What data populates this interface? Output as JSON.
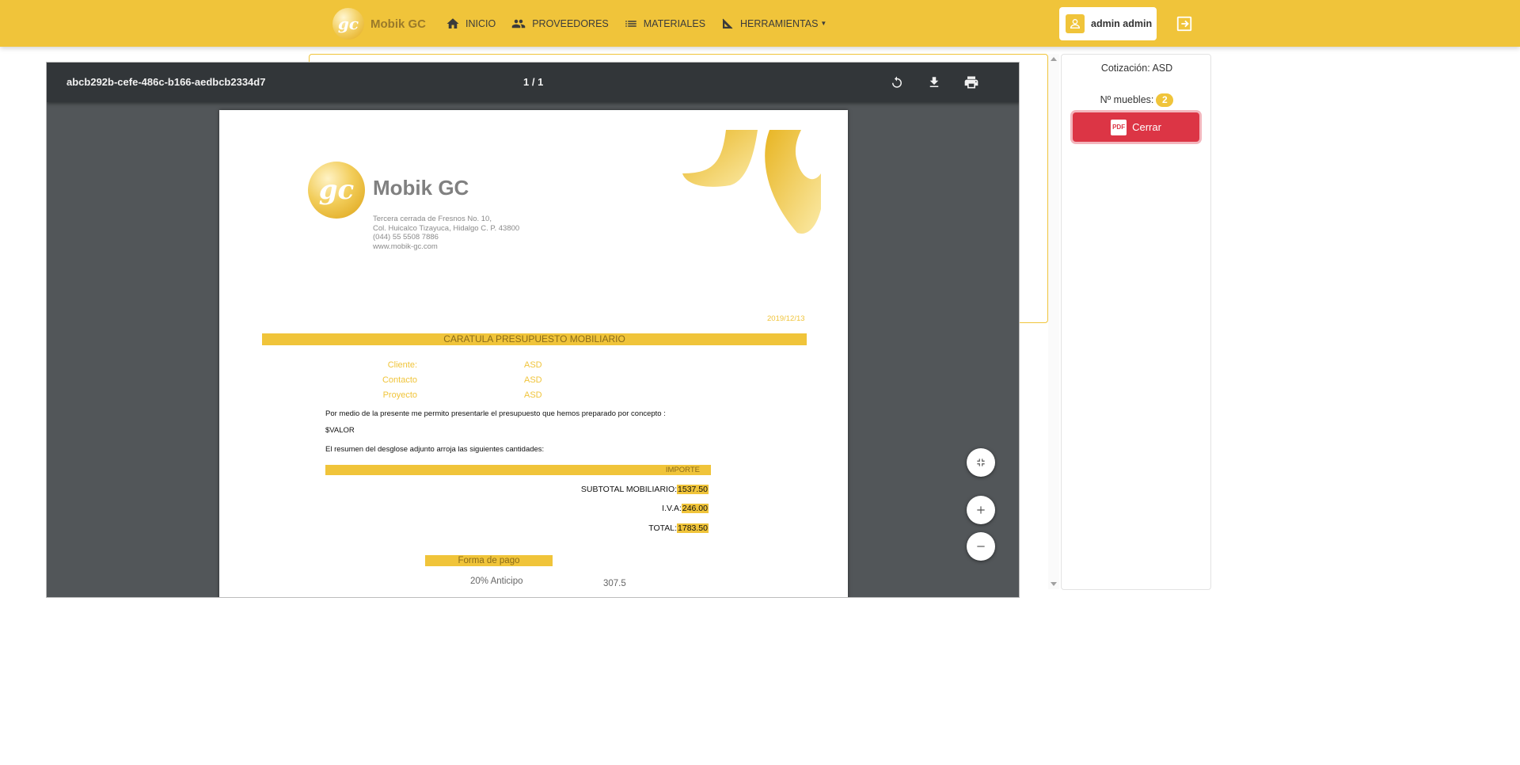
{
  "navbar": {
    "brand_name": "Mobik GC",
    "logo_text": "gc",
    "links": [
      {
        "label": "INICIO",
        "icon": "home-icon"
      },
      {
        "label": "PROVEEDORES",
        "icon": "people-icon"
      },
      {
        "label": "MATERIALES",
        "icon": "list-icon"
      },
      {
        "label": "HERRAMIENTAS",
        "icon": "ruler-icon"
      }
    ],
    "user_label": "admin admin",
    "logout_icon": "logout-icon"
  },
  "viewer": {
    "doc_title": "abcb292b-cefe-486c-b166-aedbcb2334d7",
    "page_counter": "1 / 1",
    "toolbar_icons": [
      "rotate-icon",
      "download-icon",
      "print-icon"
    ],
    "zoom_icons": [
      "fit-page-icon",
      "zoom-in-icon",
      "zoom-out-icon"
    ]
  },
  "document": {
    "brand_name": "Mobik GC",
    "logo_text": "gc",
    "address": [
      "Tercera cerrada de Fresnos No. 10,",
      "Col. Huicalco Tizayuca, Hidalgo  C. P. 43800",
      "(044) 55 5508 7886",
      "www.mobik-gc.com"
    ],
    "date": "2019/12/13",
    "title": "CARATULA PRESUPUESTO MOBILIARIO",
    "fields": [
      {
        "label": "Cliente:",
        "value": "ASD"
      },
      {
        "label": "Contacto",
        "value": "ASD"
      },
      {
        "label": "Proyecto",
        "value": "ASD"
      }
    ],
    "intro_text": "Por medio de la presente me permito presentarle el presupuesto que hemos preparado por concepto :",
    "valor_placeholder": "$VALOR",
    "summary_text": "El resumen del desglose adjunto arroja las siguientes cantidades:",
    "importe_header": "IMPORTE",
    "totals": [
      {
        "label": "SUBTOTAL MOBILIARIO:",
        "value": "1537.50"
      },
      {
        "label": "I.V.A:",
        "value": "246.00"
      },
      {
        "label": "TOTAL:",
        "value": "1783.50"
      }
    ],
    "payment_header": "Forma de pago",
    "payment_rows": [
      {
        "label": "20% Anticipo",
        "value": "307.5"
      }
    ]
  },
  "side_panel": {
    "cotizacion_label": "Cotización: ASD",
    "muebles_label": "Nº muebles:",
    "muebles_count": "2",
    "close_label": "Cerrar",
    "close_icon": "pdf-icon"
  },
  "colors": {
    "brand_yellow": "#f0c43a",
    "danger_red": "#dc3545",
    "viewer_toolbar": "#323639",
    "viewer_bg": "#525659"
  }
}
